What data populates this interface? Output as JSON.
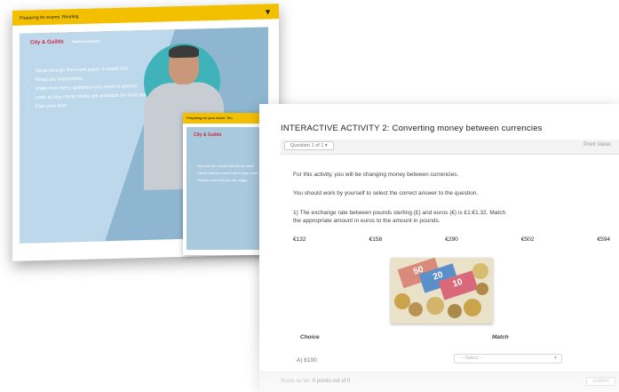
{
  "back_card": {
    "title": "Preparing for exams: Reading",
    "logo": "City & Guilds",
    "logo_sub": "Maths & English",
    "bullets": [
      "Read through the exam paper in detail first",
      "Read any instructions",
      "Make how many questions you need to answer",
      "Look at how many marks are available for each question",
      "Plan your time"
    ]
  },
  "mini_card": {
    "title": "Preparing for your exam: Tim",
    "logo": "City & Guilds",
    "logo_sub": "Maths & English",
    "bullets": [
      "Find out the venue that will be used",
      "Check that you know how it may come",
      "Practise and test you are happy"
    ]
  },
  "activity": {
    "title": "INTERACTIVE ACTIVITY 2: Converting money between currencies",
    "question_selector": "Question 1 of 1",
    "point_value": "Point Value:",
    "intro": "For this activity, you will be changing money between currencies.",
    "instruction": "You should work by yourself to select the correct answer to the question.",
    "question_line1": "1) The exchange rate between pounds sterling (£) and euros (€) is £1:€1.32. Match",
    "question_line2": "the appropriate amount in euros to the amount in pounds.",
    "euro_options": [
      "€132",
      "€158",
      "€290",
      "€502",
      "€594"
    ],
    "table_headers": {
      "choice": "Choice",
      "match": "Match"
    },
    "choices": [
      {
        "label": "A) £100",
        "select": "-- Select --"
      }
    ],
    "score_label": "Score so far:",
    "score_value": "0 points out of 0",
    "submit": "SUBMIT"
  },
  "colors": {
    "yellow": "#f3c000",
    "teal": "#3fb3b9",
    "blue_panel": "#bcd8ea"
  },
  "icons": [
    "dropdown-caret-icon",
    "chevron-down-icon"
  ]
}
